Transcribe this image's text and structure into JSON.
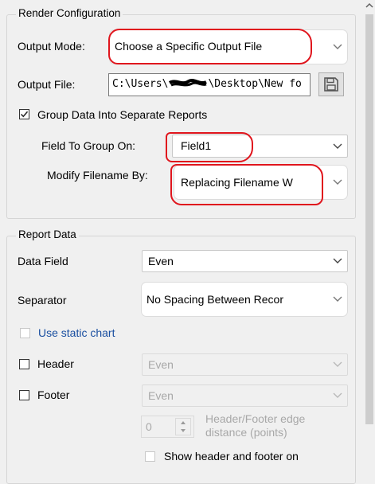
{
  "render_config": {
    "title": "Render Configuration",
    "output_mode": {
      "label": "Output Mode:",
      "value": "Choose a Specific Output File"
    },
    "output_file": {
      "label": "Output File:",
      "value_before": "C:\\Users\\",
      "value_after": "\\Desktop\\New fo"
    },
    "group_data": {
      "label": "Group Data Into Separate Reports",
      "checked": true
    },
    "field_to_group_on": {
      "label": "Field To Group On:",
      "value": "Field1"
    },
    "modify_filename_by": {
      "label": "Modify Filename By:",
      "value": "Replacing Filename W"
    }
  },
  "report_data": {
    "title": "Report Data",
    "data_field": {
      "label": "Data Field",
      "value": "Even"
    },
    "separator": {
      "label": "Separator",
      "value": "No Spacing Between Recor"
    },
    "use_static_chart": {
      "label": "Use static chart",
      "checked": false
    },
    "header": {
      "label": "Header",
      "value": "Even",
      "checked": false
    },
    "footer": {
      "label": "Footer",
      "value": "Even",
      "checked": false
    },
    "edge_distance": {
      "value": "0",
      "label_line1": "Header/Footer edge",
      "label_line2": "distance (points)"
    },
    "show_header_footer": {
      "label": "Show header and footer on",
      "checked": false
    }
  },
  "colors": {
    "annotation_red": "#e0151d",
    "disabled_text": "#a8a8a8",
    "link_blue": "#1a4fa0"
  }
}
